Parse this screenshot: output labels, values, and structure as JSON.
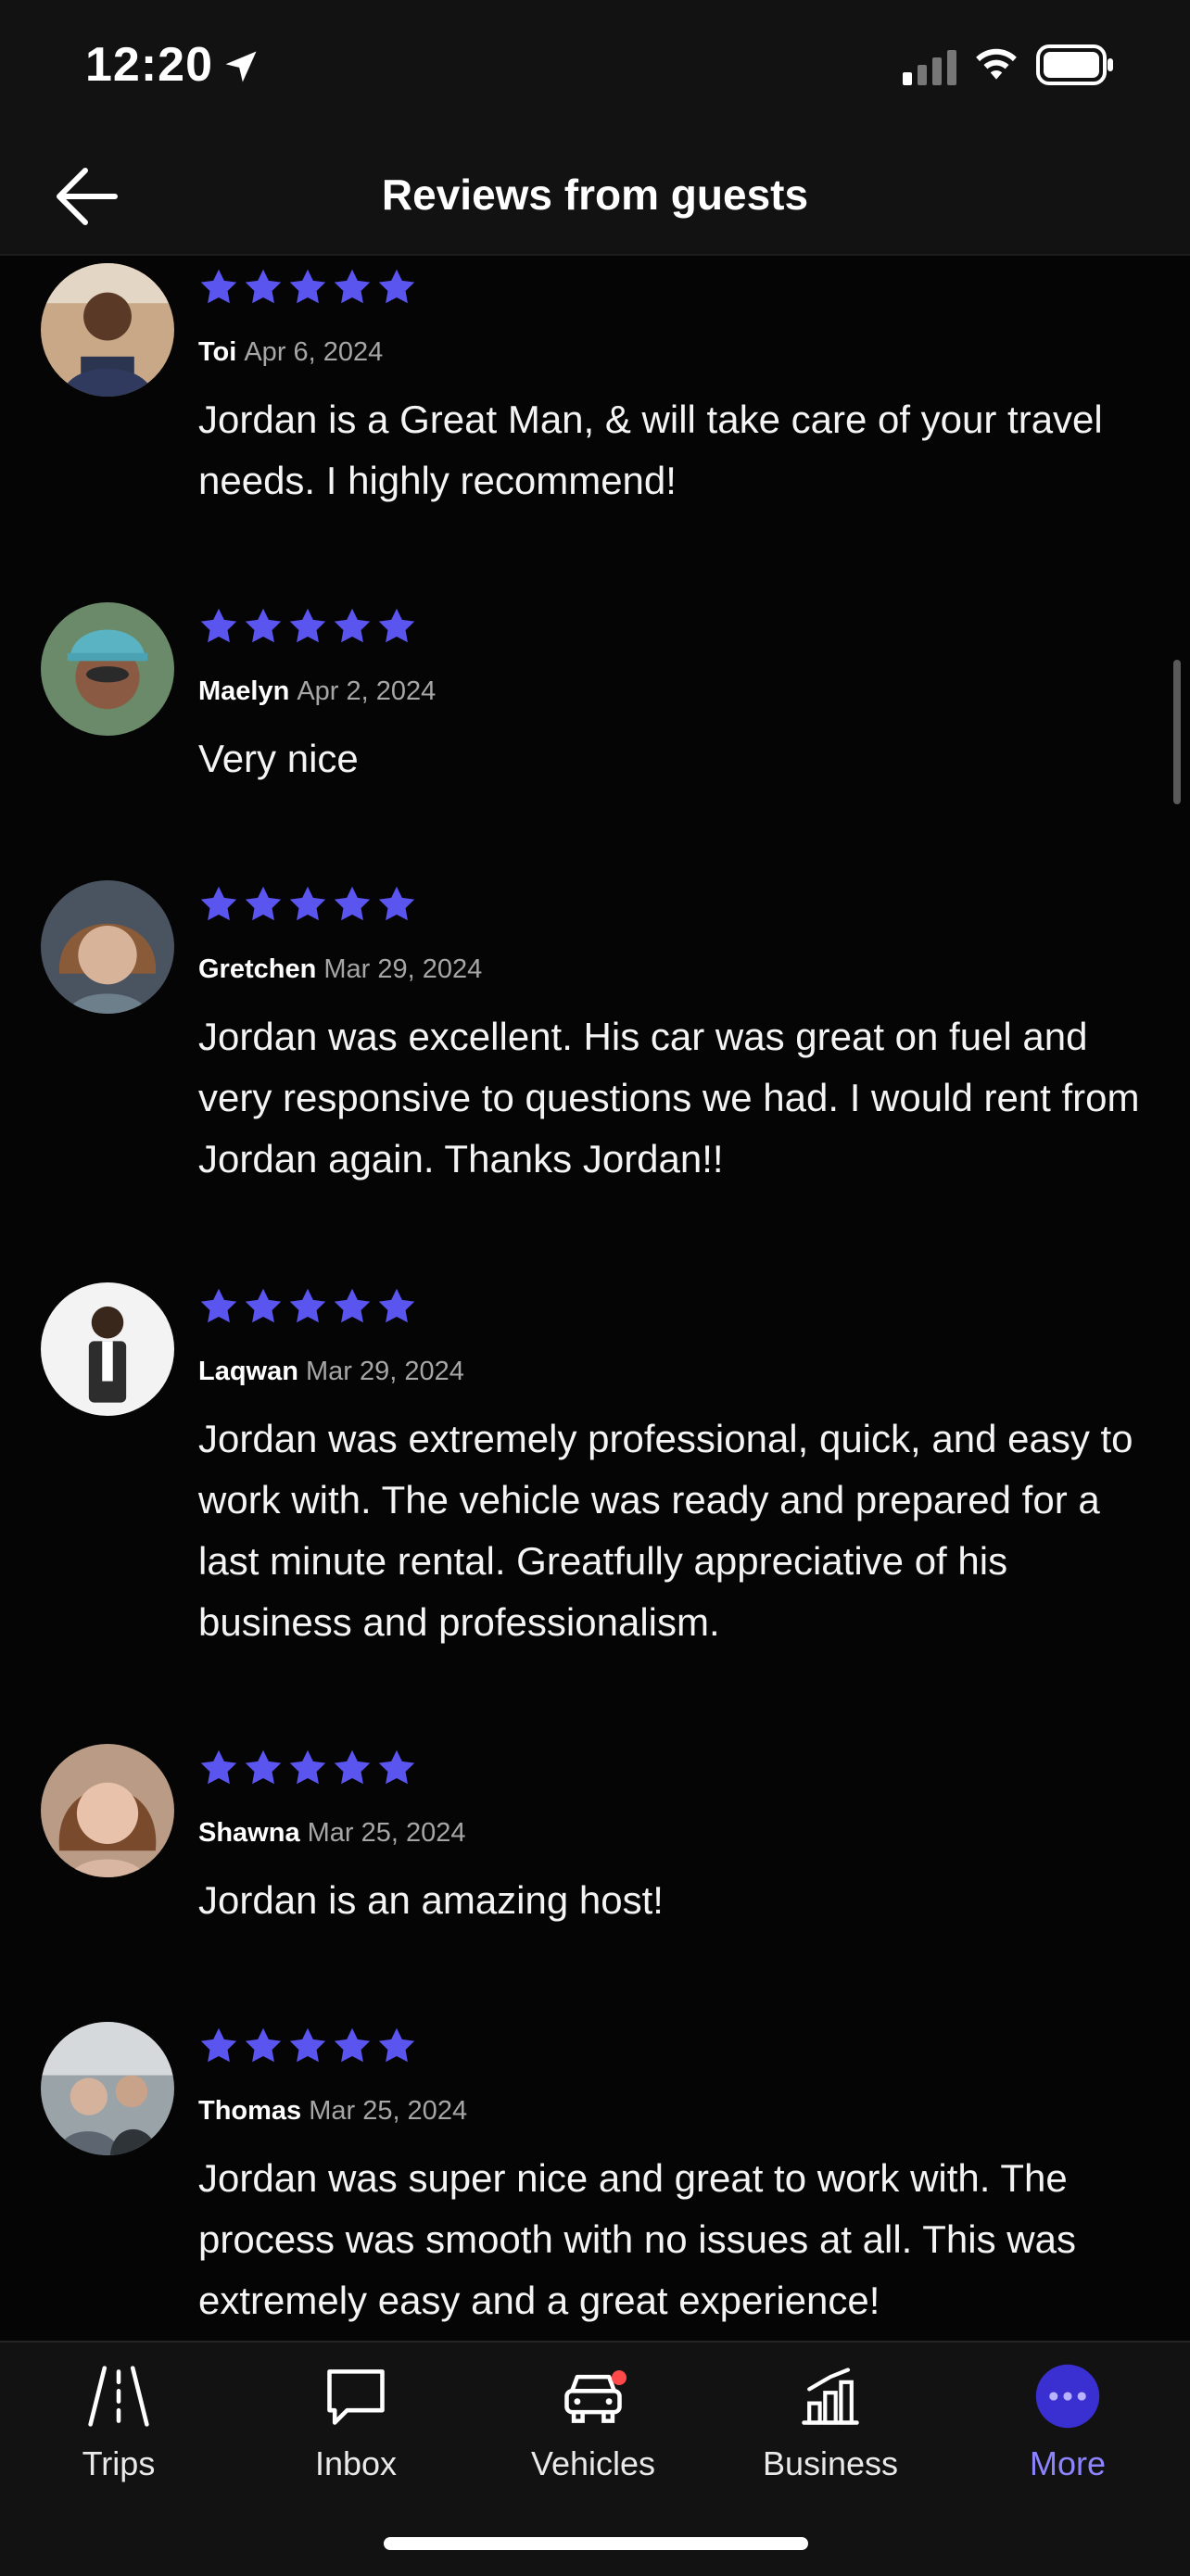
{
  "status_bar": {
    "time": "12:20"
  },
  "header": {
    "title": "Reviews from guests"
  },
  "colors": {
    "accent": "#6a5cff",
    "star": "#5b55f0",
    "badge": "#ff4a4a"
  },
  "reviews": [
    {
      "name": "Toi",
      "date": "Apr 6, 2024",
      "rating": 5,
      "text": "Jordan is a Great Man, & will take care of your travel needs. I highly recommend!"
    },
    {
      "name": "Maelyn",
      "date": "Apr 2, 2024",
      "rating": 5,
      "text": "Very nice"
    },
    {
      "name": "Gretchen",
      "date": "Mar 29, 2024",
      "rating": 5,
      "text": "Jordan was excellent. His car was great on fuel and very responsive to questions we had. I would rent from Jordan again. Thanks Jordan!!"
    },
    {
      "name": "Laqwan",
      "date": "Mar 29, 2024",
      "rating": 5,
      "text": "Jordan was extremely professional, quick, and easy to work with. The vehicle was ready and prepared for a last minute rental. Greatfully appreciative of his business and professionalism."
    },
    {
      "name": "Shawna",
      "date": "Mar 25, 2024",
      "rating": 5,
      "text": "Jordan is an amazing host!"
    },
    {
      "name": "Thomas",
      "date": "Mar 25, 2024",
      "rating": 5,
      "text": "Jordan was super nice and great to work with. The process was smooth with no issues at all. This was extremely easy and a great experience!"
    }
  ],
  "tabs": [
    {
      "label": "Trips",
      "icon": "road-icon"
    },
    {
      "label": "Inbox",
      "icon": "chat-bubble-icon"
    },
    {
      "label": "Vehicles",
      "icon": "car-icon"
    },
    {
      "label": "Business",
      "icon": "bar-chart-icon"
    },
    {
      "label": "More",
      "icon": "more-dots-icon"
    }
  ]
}
